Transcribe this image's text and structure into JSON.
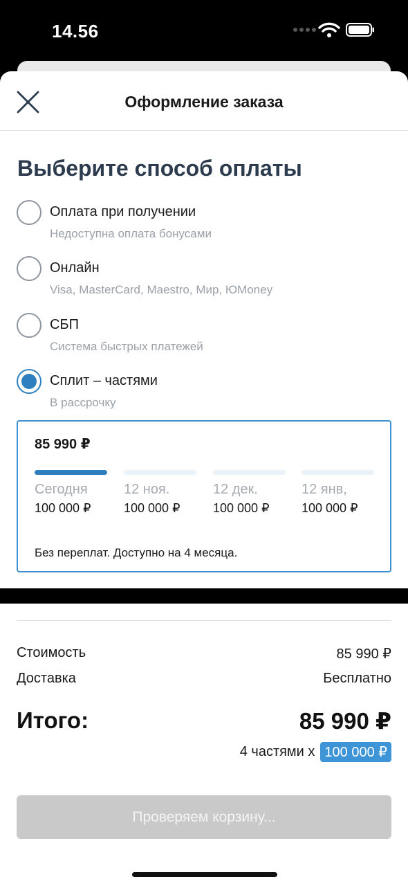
{
  "status_bar": {
    "time": "14.56"
  },
  "header": {
    "title": "Оформление заказа"
  },
  "payment": {
    "title": "Выберите способ оплаты",
    "options": [
      {
        "label": "Оплата при получении",
        "sub": "Недоступна оплата бонусами",
        "selected": false
      },
      {
        "label": "Онлайн",
        "sub": "Visa, MasterCard, Maestro, Мир, ЮMoney",
        "selected": false
      },
      {
        "label": "СБП",
        "sub": "Система быстрых платежей",
        "selected": false
      },
      {
        "label": "Сплит – частями",
        "sub": "В рассрочку",
        "selected": true
      }
    ]
  },
  "split": {
    "amount": "85 990 ₽",
    "installments": [
      {
        "date": "Сегодня",
        "amount": "100 000 ₽",
        "active": true
      },
      {
        "date": "12 ноя.",
        "amount": "100 000 ₽",
        "active": false
      },
      {
        "date": "12 дек.",
        "amount": "100 000 ₽",
        "active": false
      },
      {
        "date": "12 янв,",
        "amount": "100 000 ₽",
        "active": false
      }
    ],
    "note": "Без переплат. Доступно на 4 месяца."
  },
  "summary": {
    "cost_label": "Стоимость",
    "cost_value": "85 990 ₽",
    "delivery_label": "Доставка",
    "delivery_value": "Бесплатно",
    "total_label": "Итого:",
    "total_value": "85 990 ₽",
    "parts_text": "4 частями х",
    "parts_value": "100 000 ₽"
  },
  "checkout_button": {
    "label": "Проверяем корзину..."
  },
  "colors": {
    "accent": "#2e7fbf",
    "title": "#2d3b4e",
    "muted": "#9ba1a8",
    "badge": "#3d95d8",
    "button_disabled": "#c9c9c9"
  }
}
